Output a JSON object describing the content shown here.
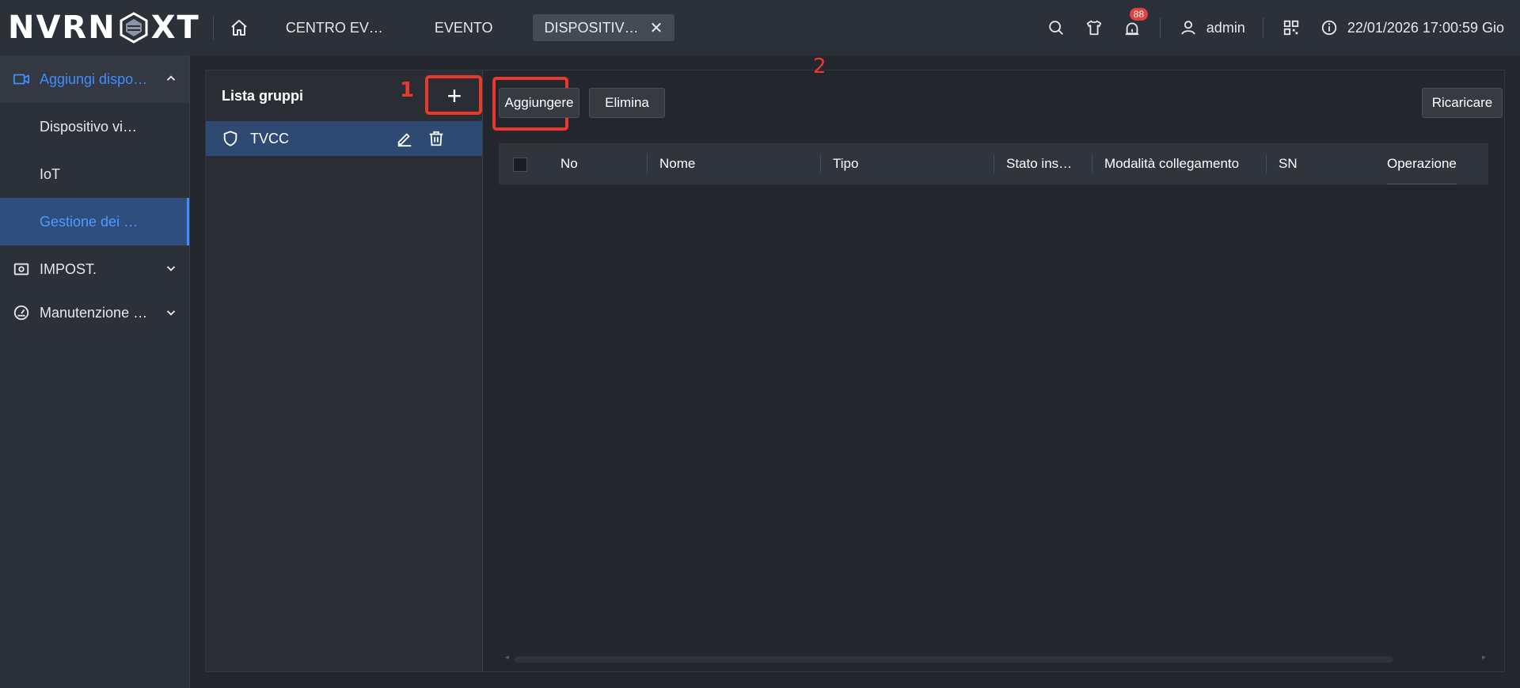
{
  "header": {
    "logo": "NVRNEXT",
    "tabs": [
      {
        "label": "CENTRO EV…"
      },
      {
        "label": "EVENTO"
      },
      {
        "label": "DISPOSITIV…",
        "active": true
      }
    ],
    "close_symbol": "✕",
    "notification_count": "88",
    "user": "admin",
    "datetime": "22/01/2026 17:00:59 Gio",
    "icons": [
      "home-icon",
      "search-icon",
      "shirt-icon",
      "alarm-icon",
      "user-icon",
      "qr-code-icon",
      "info-icon",
      "close-icon"
    ]
  },
  "sidebar": {
    "groups": [
      {
        "label": "Aggiungi dispo…",
        "icon": "video-camera-icon",
        "expanded": true,
        "items": [
          {
            "label": "Dispositivo vi…"
          },
          {
            "label": "IoT"
          },
          {
            "label": "Gestione dei …",
            "active": true
          }
        ]
      },
      {
        "label": "IMPOST.",
        "icon": "settings-box-icon",
        "expanded": false
      },
      {
        "label": "Manutenzione …",
        "icon": "gauge-icon",
        "expanded": false
      }
    ]
  },
  "groups_panel": {
    "title": "Lista gruppi",
    "annotation": "1",
    "add_symbol": "+",
    "rows": [
      {
        "label": "TVCC"
      }
    ]
  },
  "toolbar": {
    "annotation": "2",
    "add_label": "Aggiungere",
    "delete_label": "Elimina",
    "reload_label": "Ricaricare"
  },
  "table": {
    "columns": [
      "No",
      "Nome",
      "Tipo",
      "Stato ins…",
      "Modalità collegamento",
      "SN",
      "Operazione"
    ],
    "rows": []
  },
  "colors": {
    "accent": "#3f8cff",
    "annotation": "#e8392c",
    "badge": "#e0433d",
    "background": "#23262d"
  }
}
